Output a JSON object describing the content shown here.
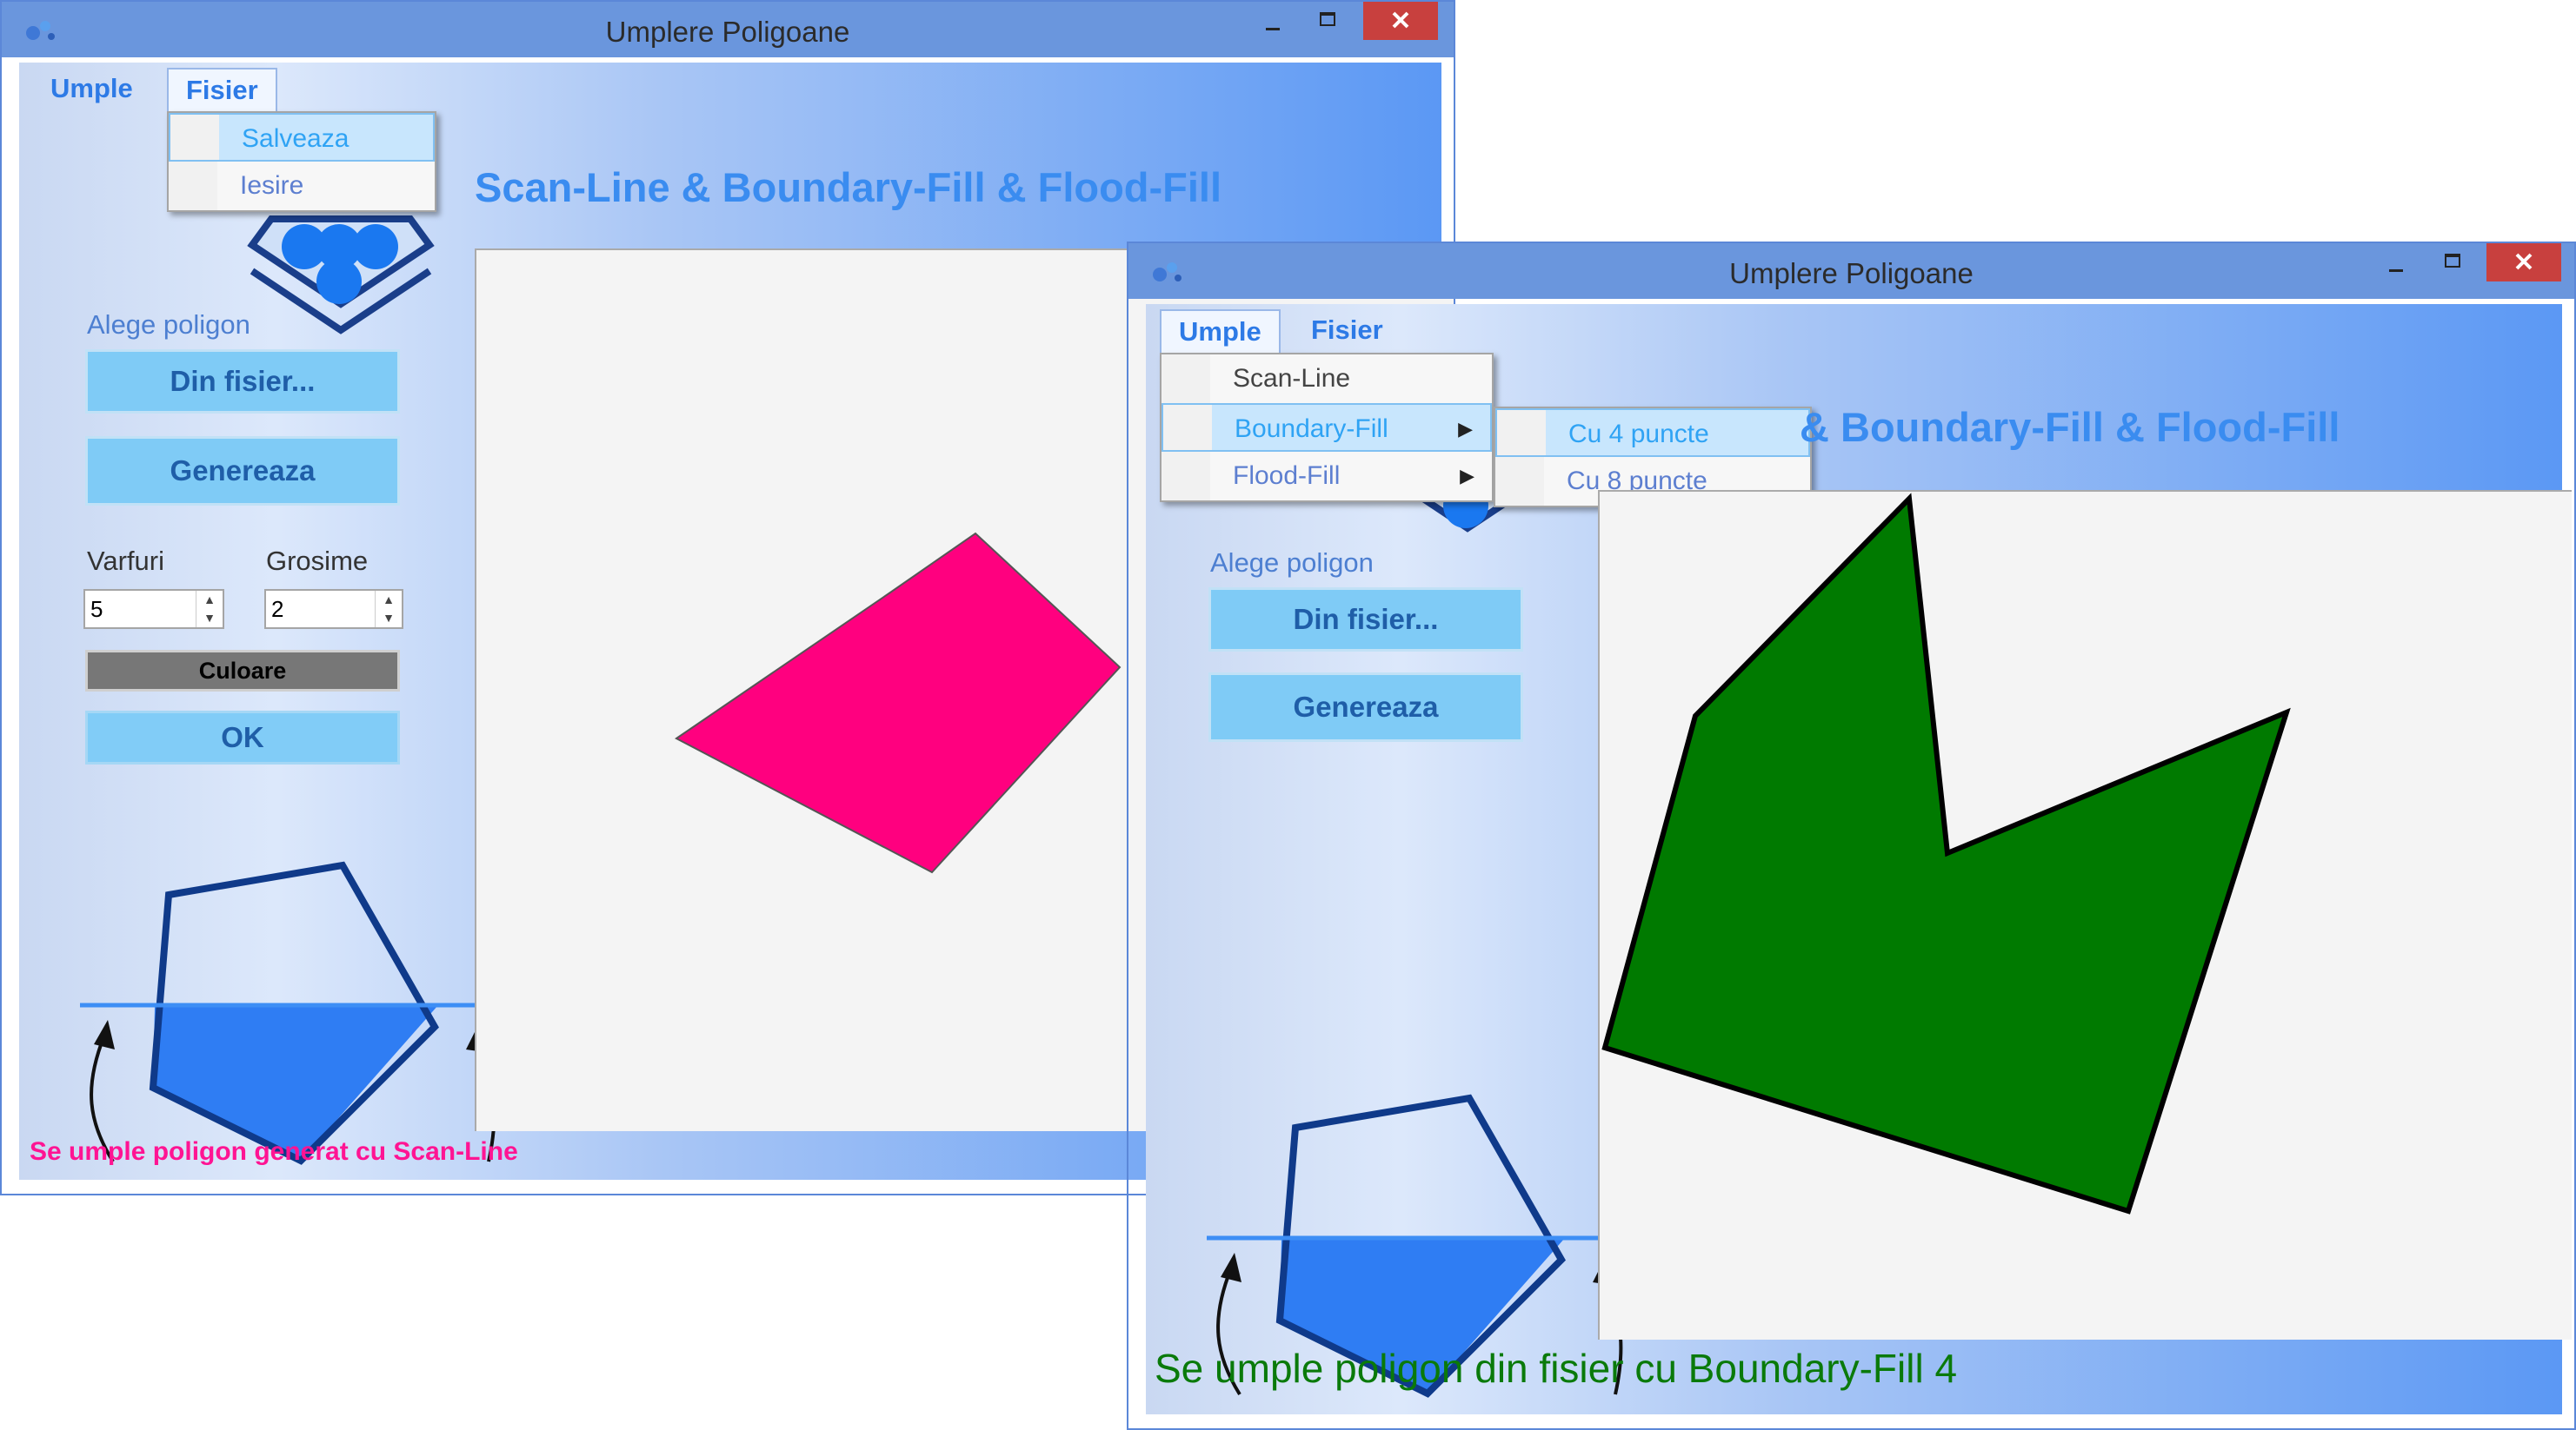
{
  "window1": {
    "title": "Umplere Poligoane",
    "menu": {
      "umple": "Umple",
      "fisier": "Fisier"
    },
    "fisier_menu": {
      "salveaza": "Salveaza",
      "iesire": "Iesire"
    },
    "heading": "Scan-Line & Boundary-Fill & Flood-Fill",
    "alege_label": "Alege poligon",
    "din_fisier": "Din fisier...",
    "genereaza": "Genereaza",
    "varfuri_label": "Varfuri",
    "varfuri_value": "5",
    "grosime_label": "Grosime",
    "grosime_value": "2",
    "culoare": "Culoare",
    "ok": "OK",
    "status": "Se umple poligon generat cu Scan-Line",
    "status_color": "#ff1493",
    "polygon_color": "#ff007f"
  },
  "window2": {
    "title": "Umplere Poligoane",
    "menu": {
      "umple": "Umple",
      "fisier": "Fisier"
    },
    "umple_menu": {
      "scan_line": "Scan-Line",
      "boundary_fill": "Boundary-Fill",
      "flood_fill": "Flood-Fill"
    },
    "boundary_submenu": {
      "cu4": "Cu 4 puncte",
      "cu8": "Cu 8 puncte"
    },
    "heading_visible": "& Boundary-Fill & Flood-Fill",
    "alege_label": "Alege poligon",
    "din_fisier": "Din fisier...",
    "genereaza": "Genereaza",
    "status": "Se umple poligon din fisier cu Boundary-Fill 4",
    "status_color": "#0a7a0a",
    "polygon_color": "#007a00"
  },
  "colors": {
    "titlebar": "#6a96dd",
    "close_button": "#c8403e",
    "accent": "#3a8cf0",
    "button": "#7fcbf6",
    "illustration_fill": "#2f7df3",
    "illustration_stroke": "#0f3a8a"
  },
  "icons": {
    "minimize": "minimize-icon",
    "maximize": "maximize-icon",
    "close": "close-icon",
    "submenu": "submenu-arrow-icon",
    "spin": "spin-arrows-icon"
  }
}
